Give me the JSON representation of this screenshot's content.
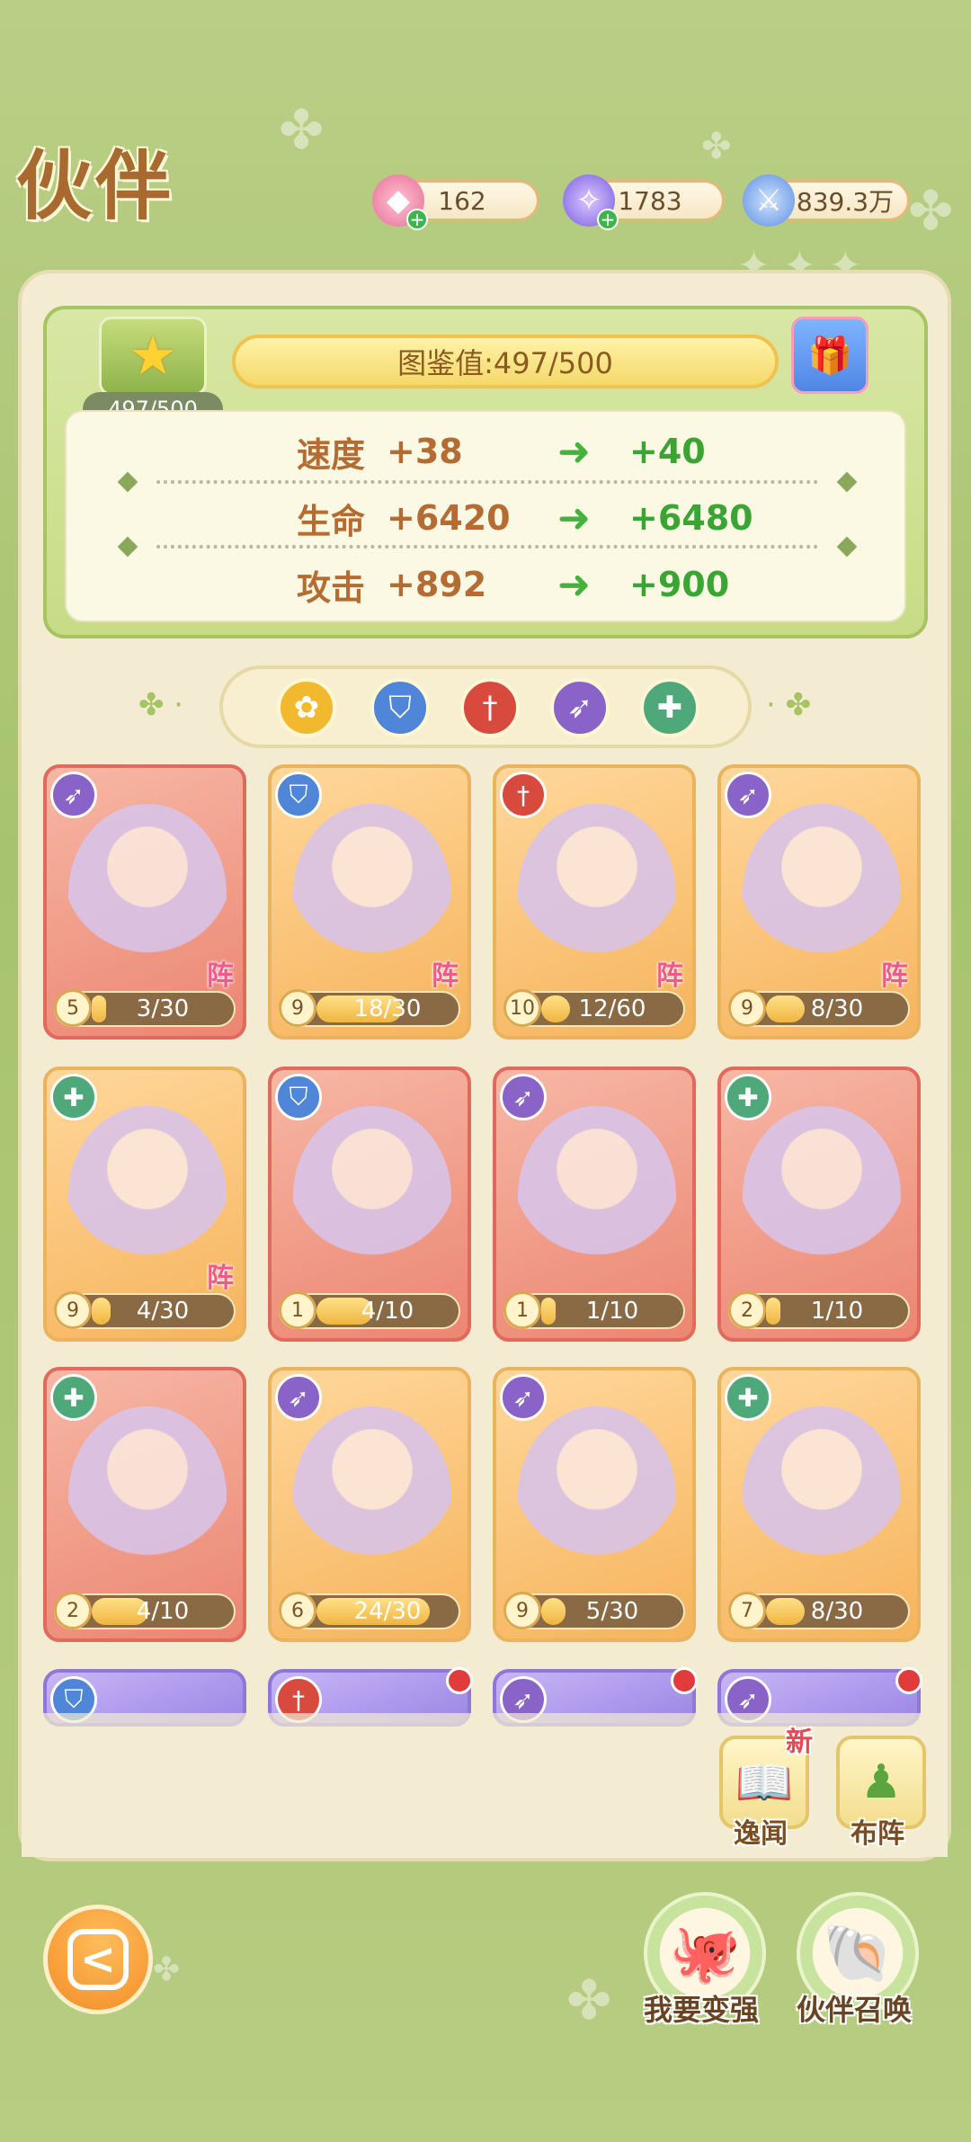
{
  "header": {
    "title": "伙伴",
    "gems": "162",
    "crystals": "1783",
    "power": "839.3万"
  },
  "collection": {
    "star_count": "497/500",
    "dex_label": "图鉴值:497/500",
    "stats": [
      {
        "name": "速度",
        "current": "+38",
        "next": "+40"
      },
      {
        "name": "生命",
        "current": "+6420",
        "next": "+6480"
      },
      {
        "name": "攻击",
        "current": "+892",
        "next": "+900"
      }
    ]
  },
  "filters": [
    {
      "name": "all",
      "icon": "flower-icon",
      "color": "#f2b92e"
    },
    {
      "name": "tank",
      "icon": "shield-icon",
      "color": "#4f86d8"
    },
    {
      "name": "warrior",
      "icon": "sword-icon",
      "color": "#d84a3d"
    },
    {
      "name": "archer",
      "icon": "bow-icon",
      "color": "#8a63c9"
    },
    {
      "name": "healer",
      "icon": "heal-icon",
      "color": "#4fa87a"
    }
  ],
  "cards": [
    {
      "class": "bow-icon",
      "bg": "red",
      "level": "5",
      "frag": "3/30",
      "progress": 0.1,
      "formation": "阵"
    },
    {
      "class": "shield-icon",
      "bg": "orange",
      "level": "9",
      "frag": "18/30",
      "progress": 0.6,
      "formation": "阵"
    },
    {
      "class": "sword-icon",
      "bg": "orange",
      "level": "10",
      "frag": "12/60",
      "progress": 0.2,
      "formation": "阵"
    },
    {
      "class": "bow-icon",
      "bg": "orange",
      "level": "9",
      "frag": "8/30",
      "progress": 0.27,
      "formation": "阵"
    },
    {
      "class": "heal-icon",
      "bg": "orange",
      "level": "9",
      "frag": "4/30",
      "progress": 0.13,
      "formation": "阵"
    },
    {
      "class": "shield-icon",
      "bg": "red",
      "level": "1",
      "frag": "4/10",
      "progress": 0.4,
      "formation": ""
    },
    {
      "class": "bow-icon",
      "bg": "red",
      "level": "1",
      "frag": "1/10",
      "progress": 0.1,
      "formation": ""
    },
    {
      "class": "heal-icon",
      "bg": "red",
      "level": "2",
      "frag": "1/10",
      "progress": 0.1,
      "formation": ""
    },
    {
      "class": "heal-icon",
      "bg": "red",
      "level": "2",
      "frag": "4/10",
      "progress": 0.4,
      "formation": ""
    },
    {
      "class": "bow-icon",
      "bg": "orange",
      "level": "6",
      "frag": "24/30",
      "progress": 0.8,
      "formation": ""
    },
    {
      "class": "bow-icon",
      "bg": "orange",
      "level": "9",
      "frag": "5/30",
      "progress": 0.17,
      "formation": ""
    },
    {
      "class": "heal-icon",
      "bg": "orange",
      "level": "7",
      "frag": "8/30",
      "progress": 0.27,
      "formation": ""
    }
  ],
  "partial_cards": [
    {
      "class": "shield-icon",
      "reddot": false
    },
    {
      "class": "sword-icon",
      "reddot": true
    },
    {
      "class": "bow-icon",
      "reddot": true
    },
    {
      "class": "bow-icon",
      "reddot": true
    }
  ],
  "side": {
    "story_label": "逸闻",
    "story_new": "新",
    "formation_label": "布阵"
  },
  "bottom": {
    "strong_label": "我要变强",
    "summon_label": "伙伴召唤"
  }
}
